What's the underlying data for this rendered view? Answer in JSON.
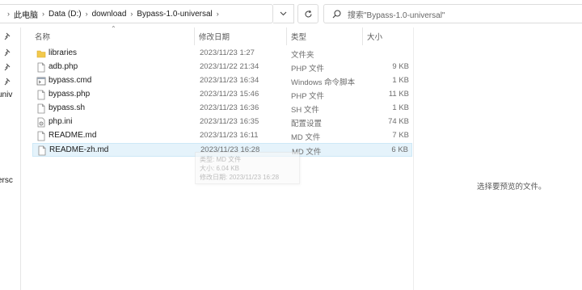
{
  "address_bar": {
    "breadcrumbs": [
      "此电脑",
      "Data (D:)",
      "download",
      "Bypass-1.0-universal"
    ]
  },
  "search": {
    "placeholder": "搜索\"Bypass-1.0-universal\""
  },
  "nav_pane": {
    "partial_labels": [
      "univ",
      "ersc"
    ]
  },
  "columns": {
    "name": "名称",
    "date": "修改日期",
    "type": "类型",
    "size": "大小"
  },
  "files": [
    {
      "name": "libraries",
      "date": "2023/11/23 1:27",
      "type": "文件夹",
      "size": "",
      "icon": "folder-icon"
    },
    {
      "name": "adb.php",
      "date": "2023/11/22 21:34",
      "type": "PHP 文件",
      "size": "9 KB",
      "icon": "file-icon"
    },
    {
      "name": "bypass.cmd",
      "date": "2023/11/23 16:34",
      "type": "Windows 命令脚本",
      "size": "1 KB",
      "icon": "cmd-script-icon"
    },
    {
      "name": "bypass.php",
      "date": "2023/11/23 15:46",
      "type": "PHP 文件",
      "size": "11 KB",
      "icon": "file-icon"
    },
    {
      "name": "bypass.sh",
      "date": "2023/11/23 16:36",
      "type": "SH 文件",
      "size": "1 KB",
      "icon": "file-icon"
    },
    {
      "name": "php.ini",
      "date": "2023/11/23 16:35",
      "type": "配置设置",
      "size": "74 KB",
      "icon": "settings-file-icon"
    },
    {
      "name": "README.md",
      "date": "2023/11/23 16:11",
      "type": "MD 文件",
      "size": "7 KB",
      "icon": "file-icon"
    },
    {
      "name": "README-zh.md",
      "date": "2023/11/23 16:28",
      "type": "MD 文件",
      "size": "6 KB",
      "icon": "file-icon",
      "selected": true
    }
  ],
  "tooltip": {
    "type_line": "类型: MD 文件",
    "size_line": "大小: 6.04 KB",
    "date_line": "修改日期: 2023/11/23 16:28"
  },
  "preview": {
    "message": "选择要预览的文件。"
  },
  "colors": {
    "selection_bg": "#e5f3fb",
    "selection_border": "#cde8f7",
    "folder_yellow": "#f2c94c"
  }
}
